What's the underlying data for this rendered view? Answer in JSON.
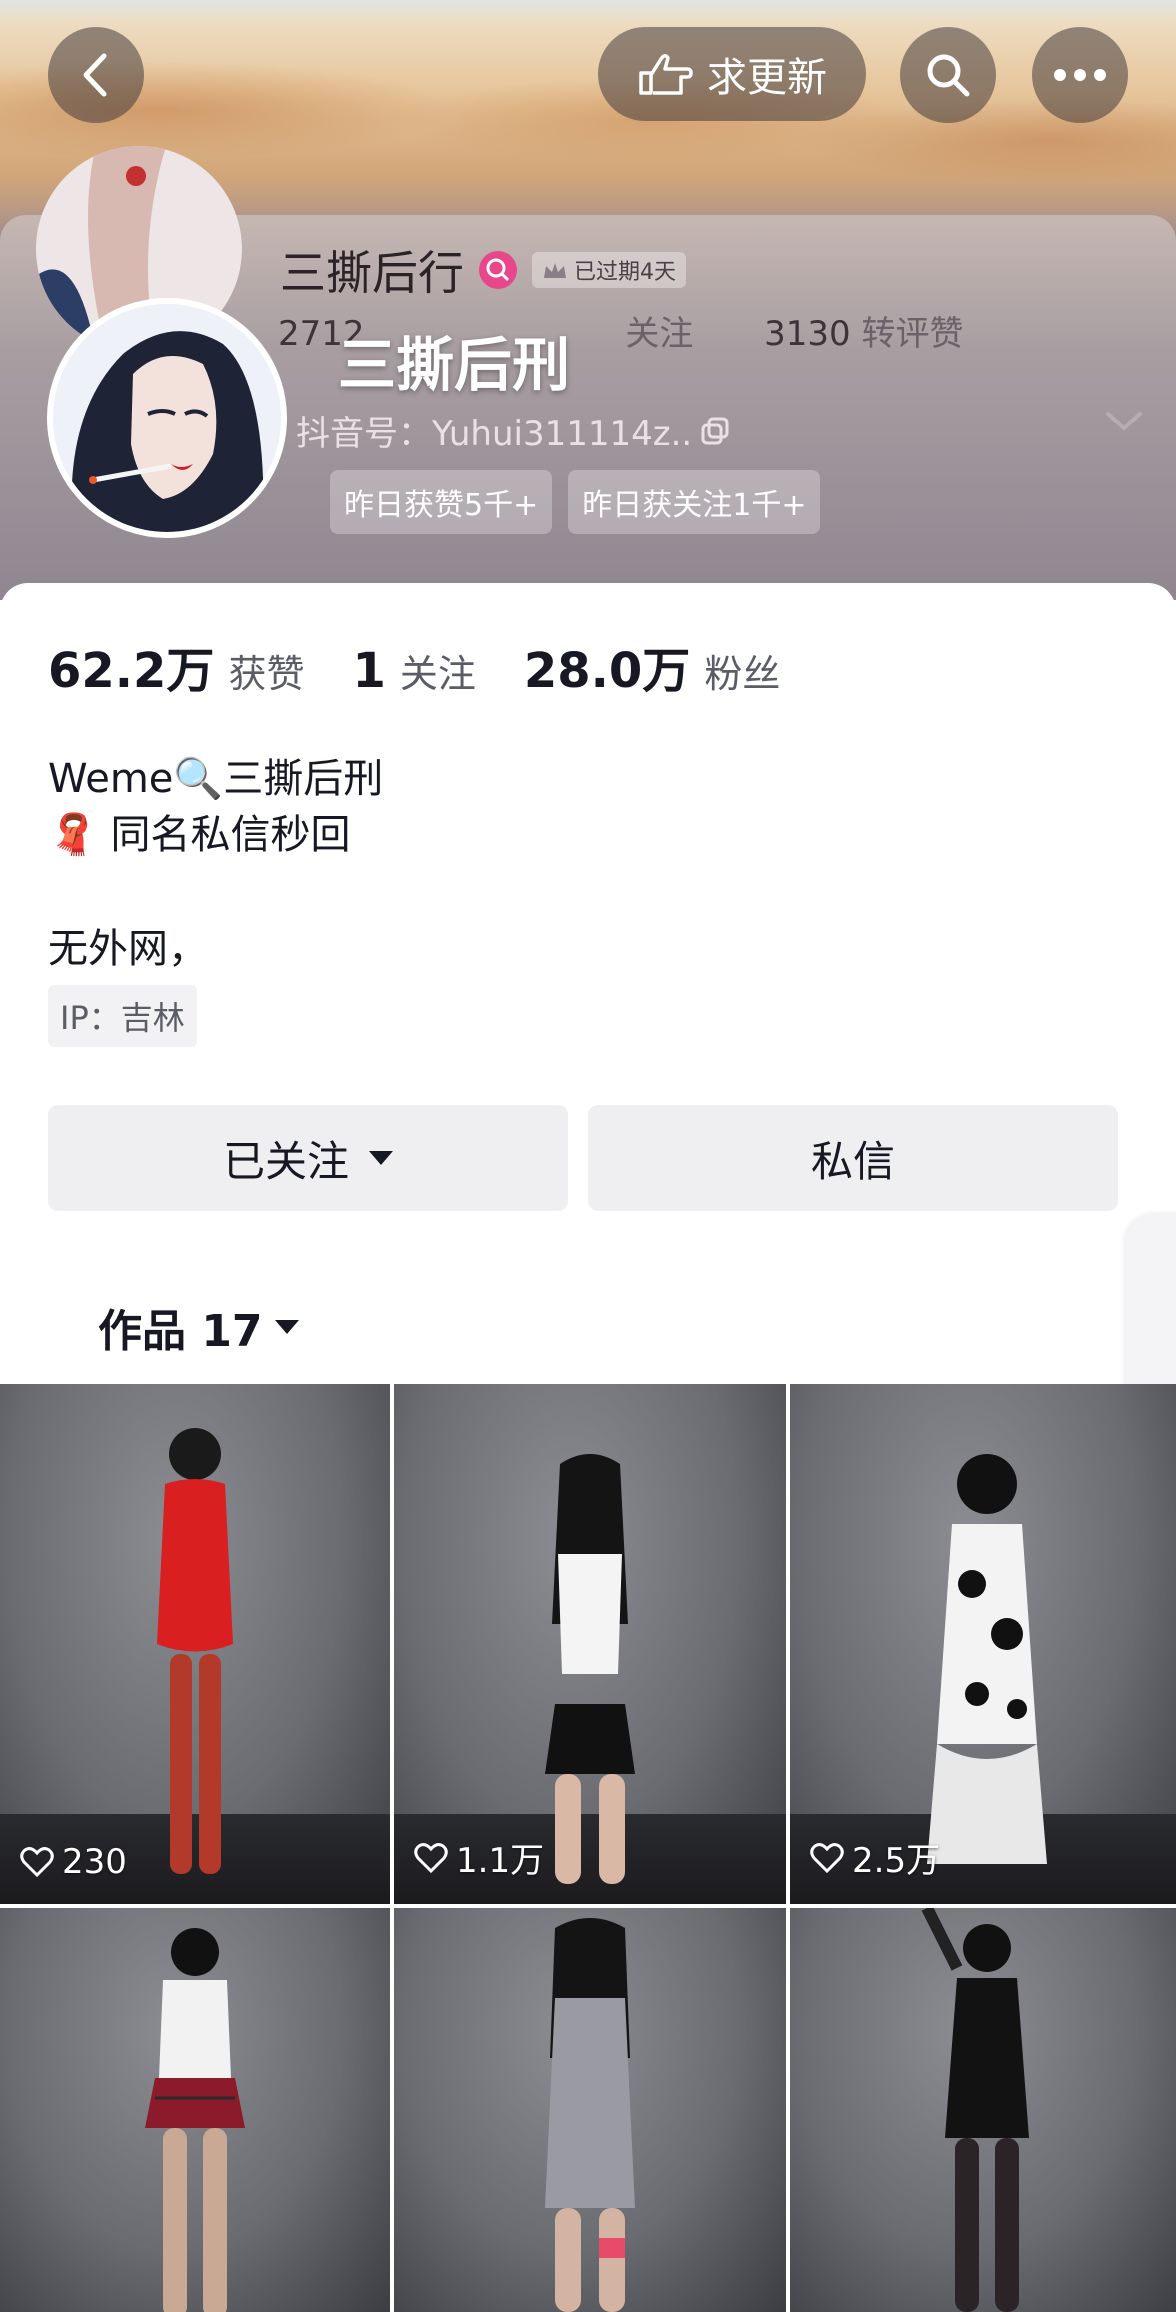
{
  "header": {
    "back_icon": "chevron-left-icon",
    "request_update_label": "求更新",
    "request_update_icon": "hand-point-icon",
    "search_icon": "search-icon",
    "more_icon": "more-dots-icon"
  },
  "profile": {
    "name": "三撕后行",
    "expired_badge": "已过期4天",
    "stats_ghost_left": "2712",
    "stats_ghost_mid": "关注",
    "stats_ghost_right_num": "3130",
    "stats_ghost_right_label": "转评赞",
    "overlay_title": "三撕后刑",
    "douyin_id": "抖音号：Yuhui311114z..",
    "badge_likes": "昨日获赞5千+",
    "badge_follow": "昨日获关注1千+"
  },
  "stats": {
    "likes_num": "62.2万",
    "likes_label": "获赞",
    "following_num": "1",
    "following_label": "关注",
    "fans_num": "28.0万",
    "fans_label": "粉丝"
  },
  "bio": {
    "line1": "Weme🔍三撕后刑",
    "line2": "🧣 同名私信秒回",
    "line3": "无外网，",
    "ip": "IP：吉林"
  },
  "actions": {
    "following_label": "已关注",
    "message_label": "私信"
  },
  "tabs": {
    "works_label": "作品 17"
  },
  "videos": [
    {
      "likes": "230"
    },
    {
      "likes": "1.1万"
    },
    {
      "likes": "2.5万"
    },
    {
      "likes": ""
    },
    {
      "likes": ""
    },
    {
      "likes": ""
    }
  ],
  "colors": {
    "accent_pink": "#fe2c55",
    "button_bg": "#efeff1",
    "text_primary": "#161823"
  }
}
